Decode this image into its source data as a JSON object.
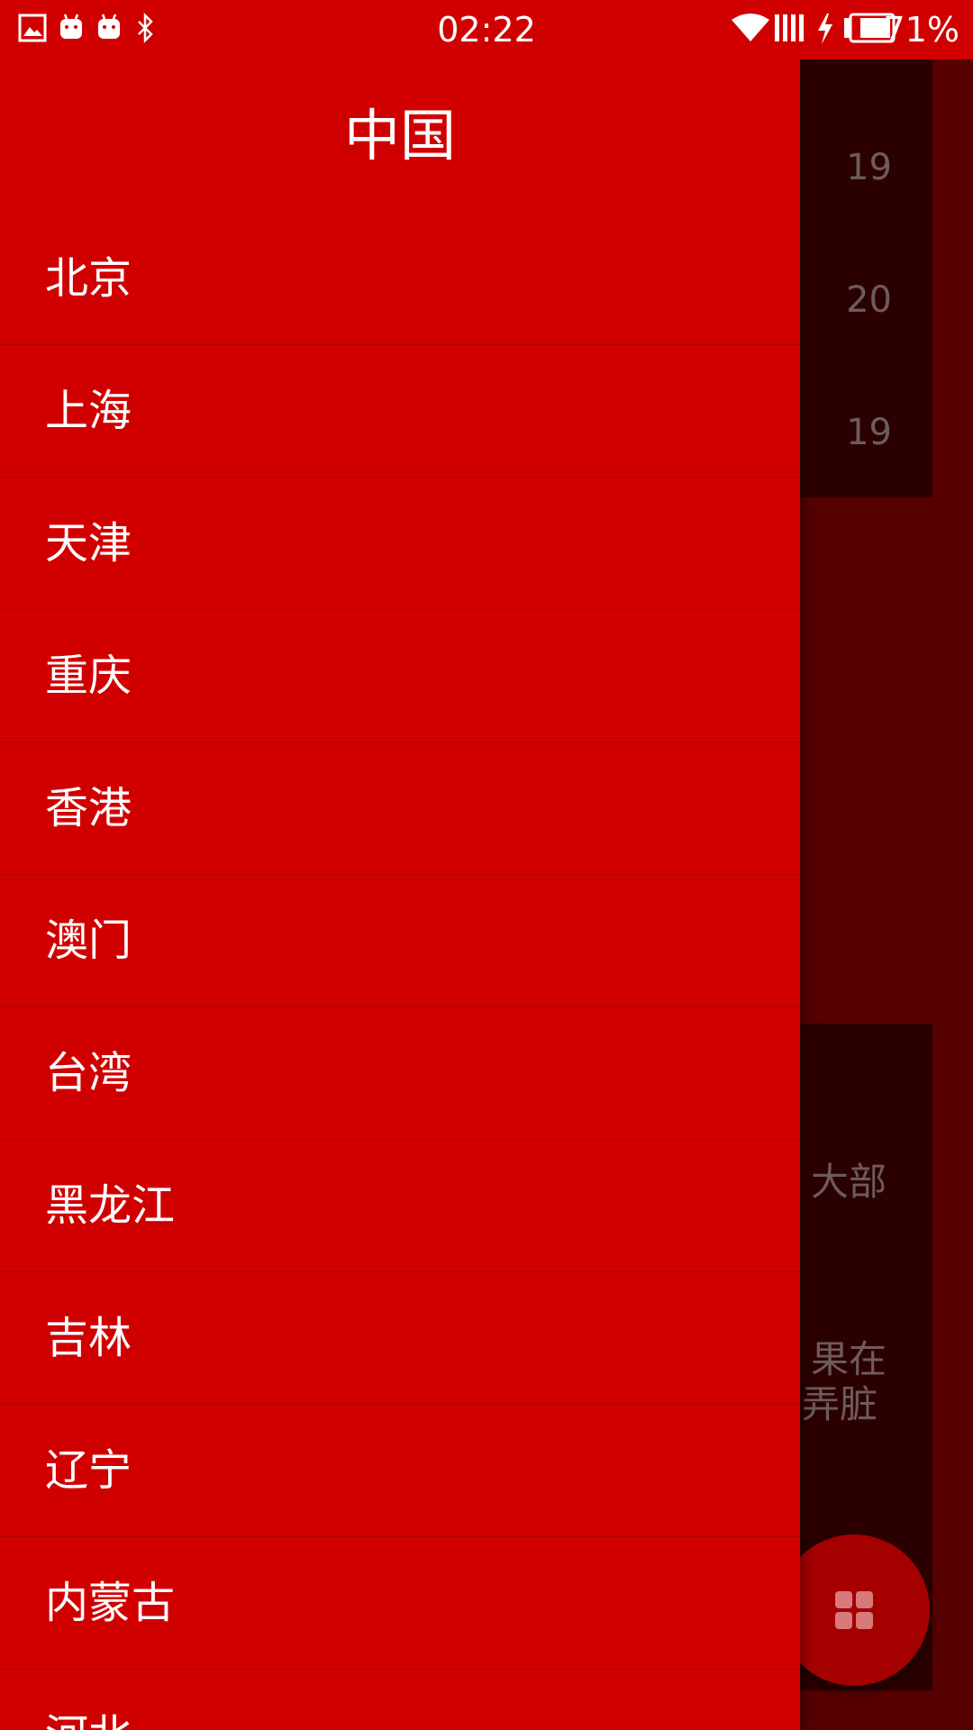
{
  "status_bar": {
    "time": "02:22",
    "battery": "71%"
  },
  "drawer": {
    "title": "中国",
    "items": [
      {
        "label": "北京"
      },
      {
        "label": "上海"
      },
      {
        "label": "天津"
      },
      {
        "label": "重庆"
      },
      {
        "label": "香港"
      },
      {
        "label": "澳门"
      },
      {
        "label": "台湾"
      },
      {
        "label": "黑龙江"
      },
      {
        "label": "吉林"
      },
      {
        "label": "辽宁"
      },
      {
        "label": "内蒙古"
      },
      {
        "label": "河北"
      }
    ]
  },
  "background": {
    "values": [
      "19",
      "20",
      "19"
    ],
    "text_line_1": "大部",
    "text_line_2": "果在",
    "text_line_3": "弄脏"
  },
  "colors": {
    "primary": "#d10000",
    "scrim": "#560000",
    "card": "#2b0000"
  }
}
